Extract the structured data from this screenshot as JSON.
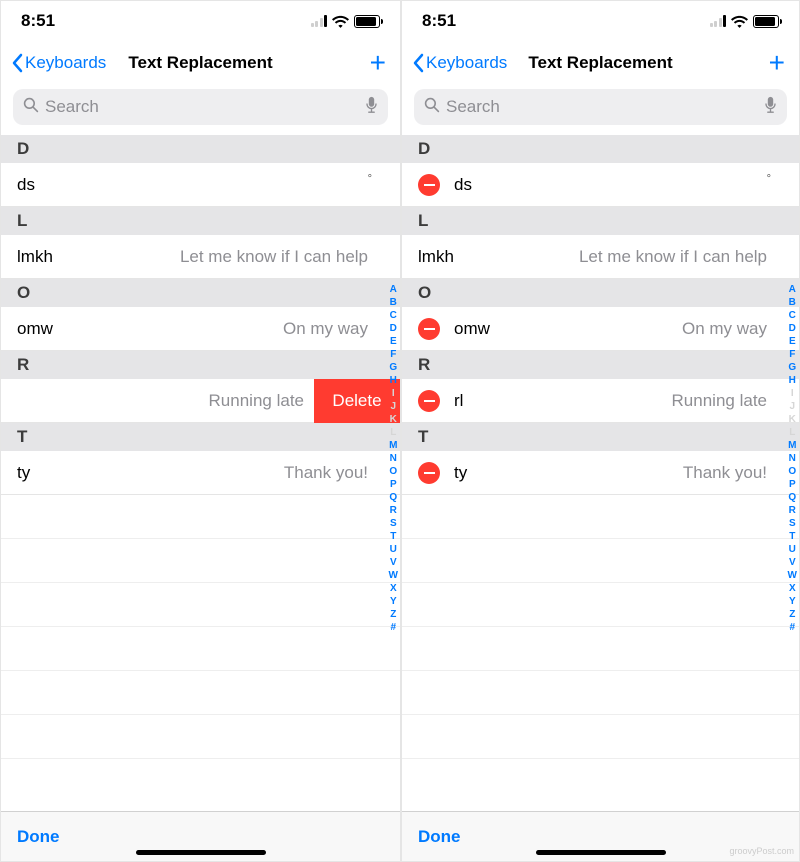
{
  "status": {
    "time": "8:51"
  },
  "nav": {
    "back": "Keyboards",
    "title": "Text Replacement"
  },
  "search": {
    "placeholder": "Search"
  },
  "toolbar": {
    "done": "Done"
  },
  "swipe": {
    "delete": "Delete"
  },
  "sections": {
    "D": {
      "header": "D",
      "items": [
        {
          "shortcut": "ds",
          "phrase": "",
          "degree": "°"
        }
      ]
    },
    "L": {
      "header": "L",
      "items": [
        {
          "shortcut": "lmkh",
          "phrase": "Let me know if I can help"
        }
      ]
    },
    "O": {
      "header": "O",
      "items": [
        {
          "shortcut": "omw",
          "phrase": "On my way"
        }
      ]
    },
    "R": {
      "header": "R",
      "items_left": [
        {
          "shortcut": "",
          "phrase": "Running late",
          "swiped": true
        }
      ],
      "items_right": [
        {
          "shortcut": "rl",
          "phrase": "Running late"
        }
      ]
    },
    "T": {
      "header": "T",
      "items": [
        {
          "shortcut": "ty",
          "phrase": "Thank you!"
        }
      ]
    }
  },
  "index": [
    "A",
    "B",
    "C",
    "D",
    "E",
    "F",
    "G",
    "H",
    "I",
    "J",
    "K",
    "L",
    "M",
    "N",
    "O",
    "P",
    "Q",
    "R",
    "S",
    "T",
    "U",
    "V",
    "W",
    "X",
    "Y",
    "Z",
    "#"
  ],
  "watermark": "groovyPost.com"
}
